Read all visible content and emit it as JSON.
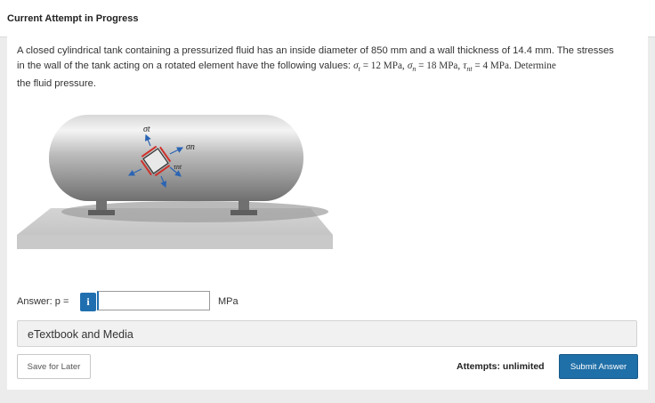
{
  "header": {
    "title": "Current Attempt in Progress"
  },
  "question": {
    "line1": "A closed cylindrical tank containing a pressurized fluid has an inside diameter of 850 mm and a wall thickness of 14.4 mm. The stresses",
    "line2_a": "in the wall of the tank acting on a rotated element have the following values: ",
    "sigma_t_sym": "σ",
    "sigma_t_sub": "t",
    "sigma_t_eq": " = 12 MPa,",
    "sigma_n_sym": "σ",
    "sigma_n_sub": "n",
    "sigma_n_eq": " = 18 MPa,",
    "tau_nt_sym": "τ",
    "tau_nt_sub": "nt",
    "tau_nt_eq": " = 4 MPa. Determine",
    "line3": "the fluid pressure."
  },
  "figure": {
    "label_sigma_t": "σt",
    "label_sigma_n": "σn",
    "label_tau_nt": "τnt"
  },
  "answer": {
    "label": "Answer: p =",
    "info_glyph": "i",
    "value": "",
    "units": "MPa"
  },
  "etextbook": {
    "label": "eTextbook and Media"
  },
  "footer": {
    "save_label": "Save for Later",
    "attempts_label": "Attempts: unlimited",
    "submit_label": "Submit Answer"
  },
  "colors": {
    "accent": "#1f6fa8",
    "page_bg": "#ececec",
    "panel_bg": "#f1f1f1"
  }
}
